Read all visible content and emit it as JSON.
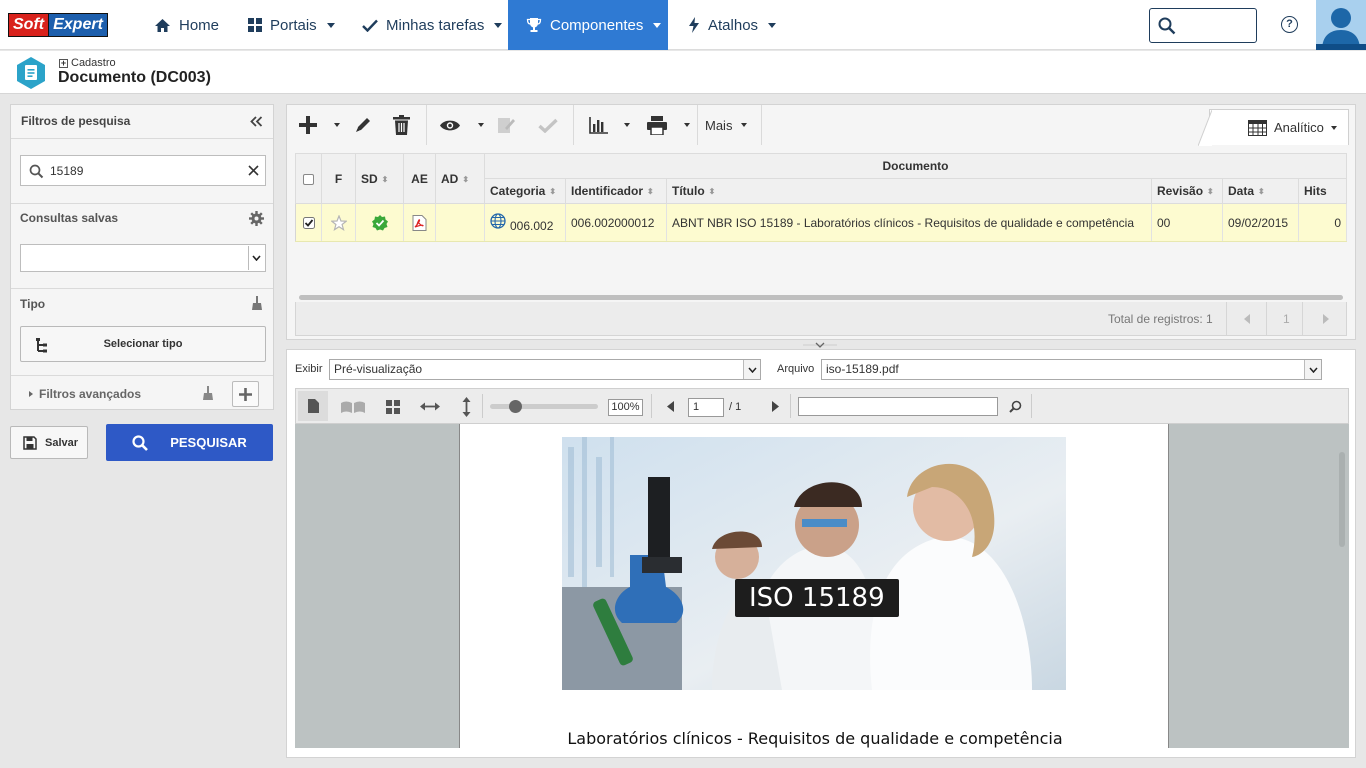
{
  "nav": {
    "logo_soft": "Soft",
    "logo_expert": "Expert",
    "items": [
      {
        "label": "Home",
        "icon": "home-icon"
      },
      {
        "label": "Portais",
        "icon": "grid-icon"
      },
      {
        "label": "Minhas tarefas",
        "icon": "check-icon"
      },
      {
        "label": "Componentes",
        "icon": "trophy-icon"
      },
      {
        "label": "Atalhos",
        "icon": "bolt-icon"
      }
    ],
    "active_item": "Componentes",
    "help": "?",
    "accent": "#2f7ad3"
  },
  "header": {
    "breadcrumb": "Cadastro",
    "title": "Documento (DC003)"
  },
  "filters": {
    "title": "Filtros de pesquisa",
    "search_value": "15189",
    "saved_label": "Consultas salvas",
    "saved_value": "",
    "tipo_label": "Tipo",
    "tipo_button": "Selecionar tipo",
    "advanced_label": "Filtros avançados",
    "save_button": "Salvar",
    "search_button": "PESQUISAR",
    "search_button_color": "#2e59c6"
  },
  "toolbar": {
    "more_label": "Mais",
    "view_label": "Analítico"
  },
  "grid": {
    "group_header": "Documento",
    "columns": [
      "F",
      "SD",
      "AE",
      "AD",
      "Categoria",
      "Identificador",
      "Título",
      "Revisão",
      "Data",
      "Hits"
    ],
    "rows": [
      {
        "checked": true,
        "categoria": "006.002",
        "identificador": "006.002000012",
        "titulo": "ABNT NBR ISO 15189 - Laboratórios clínicos - Requisitos de qualidade e competência",
        "revisao": "00",
        "data": "09/02/2015",
        "hits": "0"
      }
    ],
    "total_label": "Total de registros: 1",
    "page": "1",
    "row_highlight": "#fdfbd0"
  },
  "viewer": {
    "exibir_label": "Exibir",
    "exibir_value": "Pré-visualização",
    "arquivo_label": "Arquivo",
    "arquivo_value": "iso-15189.pdf",
    "zoom": "100%",
    "zoom_level": 0.2,
    "page_current": "1",
    "page_total": "/ 1",
    "find_value": "",
    "pdf_image_label": "ISO 15189",
    "pdf_caption": "Laboratórios clínicos - Requisitos de qualidade e competência"
  }
}
